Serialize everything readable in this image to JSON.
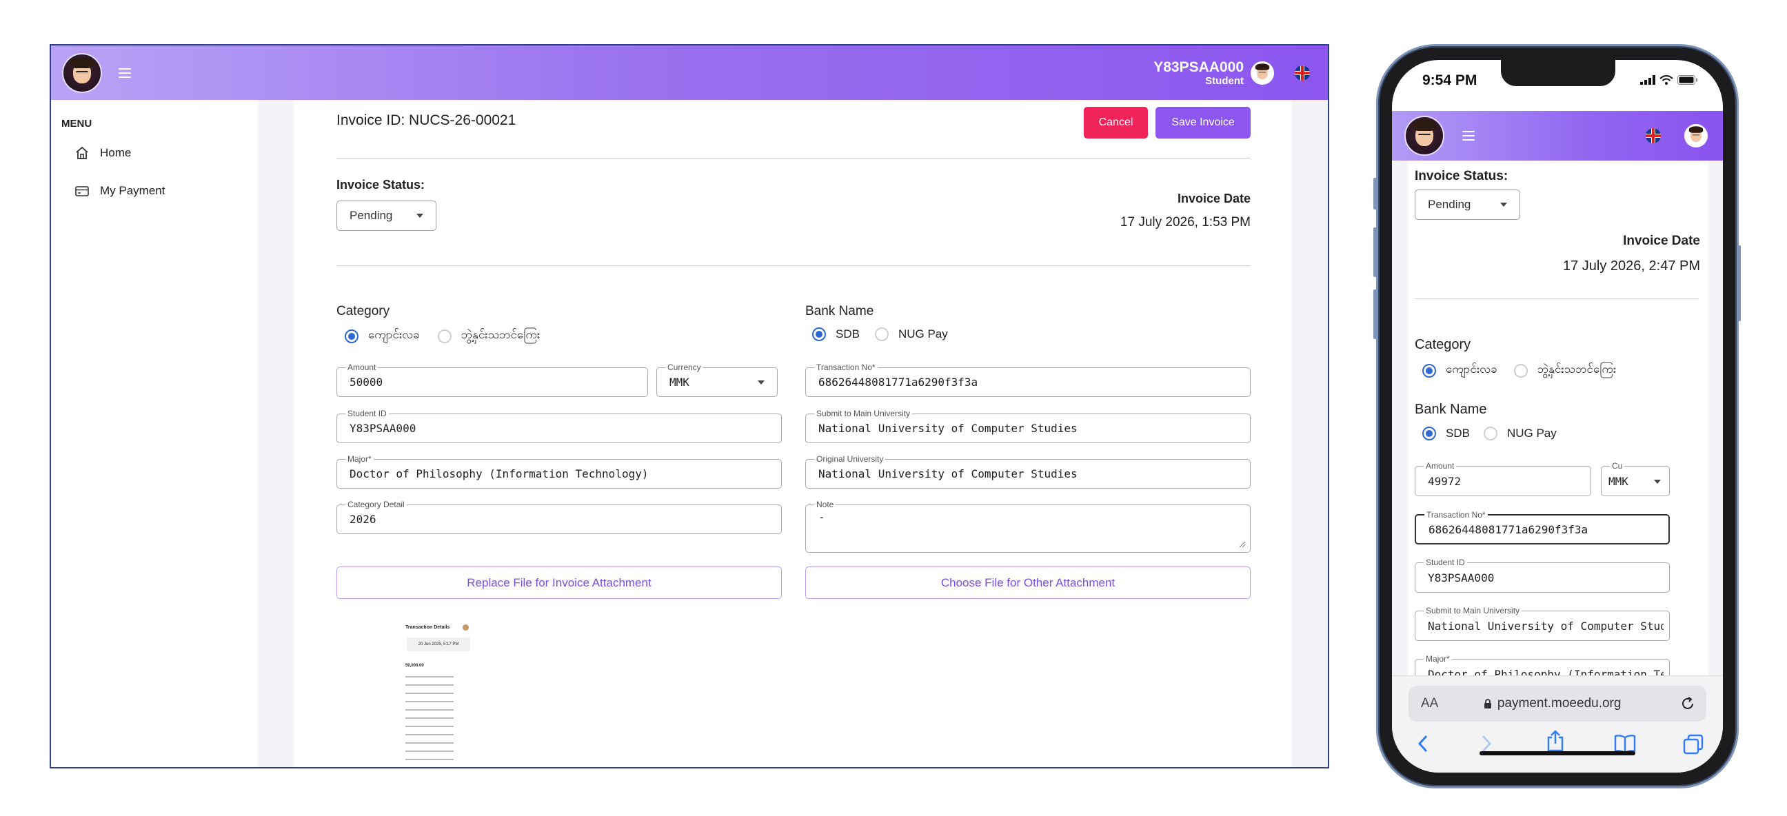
{
  "desktop": {
    "user": {
      "id": "Y83PSAA000",
      "role": "Student"
    },
    "menu": {
      "title": "MENU",
      "items": [
        {
          "label": "Home"
        },
        {
          "label": "My Payment"
        }
      ]
    },
    "invoice": {
      "id_label": "Invoice ID: NUCS-26-00021",
      "cancel_label": "Cancel",
      "save_label": "Save Invoice",
      "status_label": "Invoice Status:",
      "status_value": "Pending",
      "date_label": "Invoice Date",
      "date_value": "17 July 2026, 1:53 PM"
    },
    "category": {
      "title": "Category",
      "options": [
        "ကျောင်းလခ",
        "ဘွဲ့နှင်းသဘင်ကြေး"
      ],
      "selected": 0
    },
    "bank": {
      "title": "Bank Name",
      "options": [
        "SDB",
        "NUG Pay"
      ],
      "selected": 0
    },
    "fields": {
      "amount": {
        "label": "Amount",
        "value": "50000"
      },
      "currency": {
        "label": "Currency",
        "value": "MMK"
      },
      "transaction": {
        "label": "Transaction No*",
        "value": "68626448081771a6290f3f3a"
      },
      "student_id": {
        "label": "Student ID",
        "value": "Y83PSAA000"
      },
      "submit_univ": {
        "label": "Submit to Main University",
        "value": "National University of Computer Studies"
      },
      "major": {
        "label": "Major*",
        "value": "Doctor of Philosophy (Information Technology)"
      },
      "original_univ": {
        "label": "Original University",
        "value": "National University of Computer Studies"
      },
      "category_detail": {
        "label": "Category Detail",
        "value": "2026"
      },
      "note": {
        "label": "Note",
        "value": "-"
      }
    },
    "replace_file_label": "Replace File for Invoice Attachment",
    "choose_file_label": "Choose File for Other Attachment",
    "receipt": {
      "title": "Transaction Details",
      "time": "20 Jun 2025, 5:17 PM",
      "amount": "50,000.00"
    }
  },
  "phone": {
    "status_time": "9:54 PM",
    "invoice": {
      "status_label": "Invoice Status:",
      "status_value": "Pending",
      "date_label": "Invoice Date",
      "date_value": "17 July 2026, 2:47 PM"
    },
    "category": {
      "title": "Category",
      "options": [
        "ကျောင်းလခ",
        "ဘွဲ့နှင်းသဘင်ကြေး"
      ],
      "selected": 0
    },
    "bank": {
      "title": "Bank Name",
      "options": [
        "SDB",
        "NUG Pay"
      ],
      "selected": 0
    },
    "fields": {
      "amount": {
        "label": "Amount",
        "value": "49972"
      },
      "currency": {
        "label": "Cu",
        "value": "MMK"
      },
      "transaction": {
        "label": "Transaction No*",
        "value": "68626448081771a6290f3f3a"
      },
      "student_id": {
        "label": "Student ID",
        "value": "Y83PSAA000"
      },
      "submit_univ": {
        "label": "Submit to Main University",
        "value": "National University of Computer Studies"
      },
      "major": {
        "label": "Major*",
        "value": "Doctor of Philosophy (Information Technology)"
      }
    },
    "safari": {
      "text_size": "AA",
      "url": "payment.moeedu.org"
    }
  },
  "colors": {
    "accent": "#8c56ef",
    "cancel": "#f0245a",
    "save": "#8c56ef",
    "radio": "#2d67d1"
  }
}
